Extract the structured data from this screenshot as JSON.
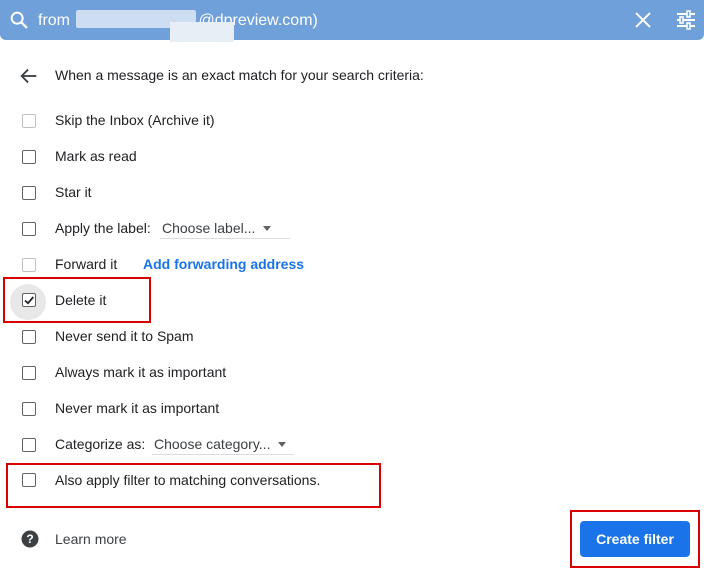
{
  "search": {
    "query_prefix": "from",
    "query_suffix": "@dpreview.com)"
  },
  "header": {
    "text": "When a message is an exact match for your search criteria:"
  },
  "options": [
    {
      "label": "Skip the Inbox (Archive it)",
      "checked": false
    },
    {
      "label": "Mark as read",
      "checked": false
    },
    {
      "label": "Star it",
      "checked": false
    },
    {
      "label": "Apply the label:",
      "checked": false,
      "dropdown": "Choose label..."
    },
    {
      "label": "Forward it",
      "checked": false,
      "link": "Add forwarding address"
    },
    {
      "label": "Delete it",
      "checked": true
    },
    {
      "label": "Never send it to Spam",
      "checked": false
    },
    {
      "label": "Always mark it as important",
      "checked": false
    },
    {
      "label": "Never mark it as important",
      "checked": false
    },
    {
      "label": "Categorize as:",
      "checked": false,
      "dropdown": "Choose category..."
    },
    {
      "label": "Also apply filter to matching conversations.",
      "checked": false
    }
  ],
  "footer": {
    "learn_more": "Learn more",
    "create_filter": "Create filter"
  },
  "colors": {
    "search_bar": "#6fa0d9",
    "primary_button": "#1a73e8",
    "link": "#1a73e8",
    "highlight_box": "#d80000"
  }
}
